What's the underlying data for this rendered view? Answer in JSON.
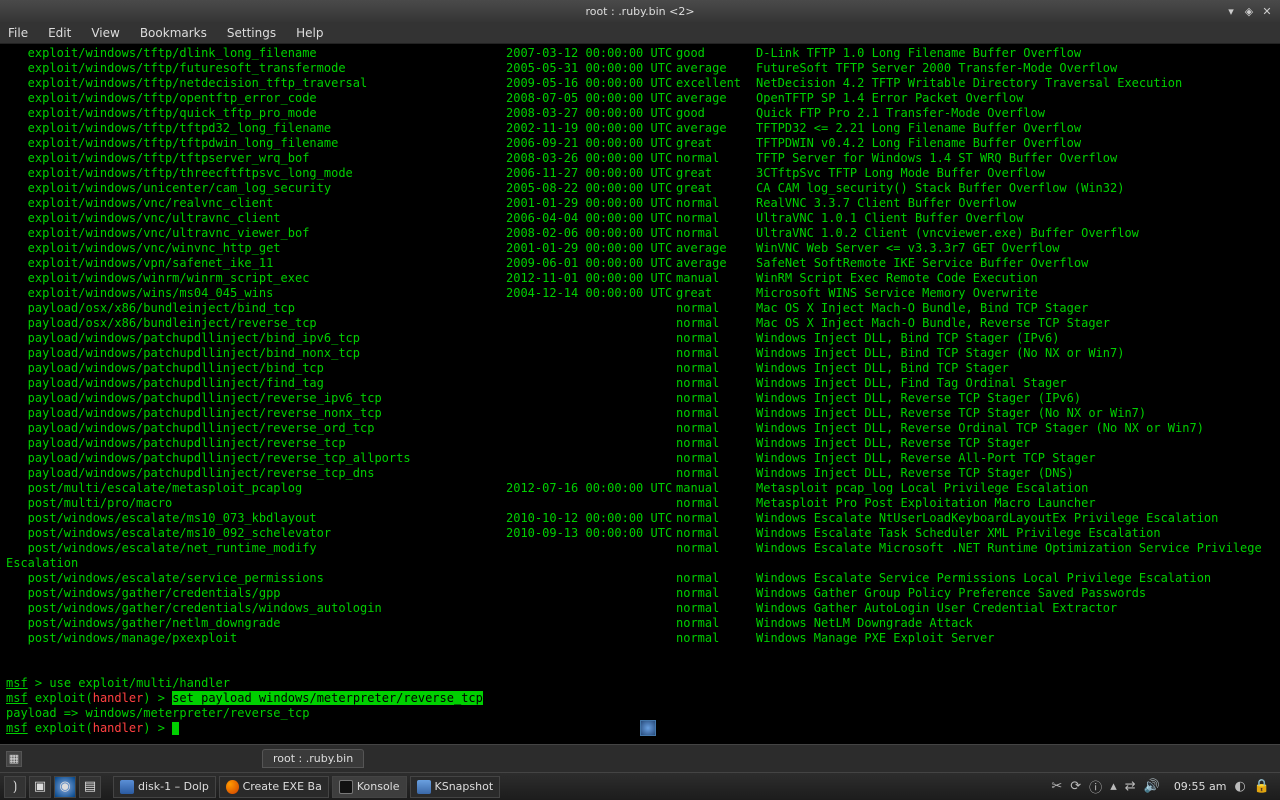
{
  "window": {
    "title": "root : .ruby.bin <2>",
    "min": "▾",
    "max": "◈",
    "close": "✕"
  },
  "menu": {
    "file": "File",
    "edit": "Edit",
    "view": "View",
    "bookmarks": "Bookmarks",
    "settings": "Settings",
    "help": "Help"
  },
  "table": {
    "rows": [
      {
        "n": "exploit/windows/tftp/dlink_long_filename",
        "d": "2007-03-12 00:00:00 UTC",
        "r": "good",
        "desc": "D-Link TFTP 1.0 Long Filename Buffer Overflow"
      },
      {
        "n": "exploit/windows/tftp/futuresoft_transfermode",
        "d": "2005-05-31 00:00:00 UTC",
        "r": "average",
        "desc": "FutureSoft TFTP Server 2000 Transfer-Mode Overflow"
      },
      {
        "n": "exploit/windows/tftp/netdecision_tftp_traversal",
        "d": "2009-05-16 00:00:00 UTC",
        "r": "excellent",
        "desc": "NetDecision 4.2 TFTP Writable Directory Traversal Execution"
      },
      {
        "n": "exploit/windows/tftp/opentftp_error_code",
        "d": "2008-07-05 00:00:00 UTC",
        "r": "average",
        "desc": "OpenTFTP SP 1.4 Error Packet Overflow"
      },
      {
        "n": "exploit/windows/tftp/quick_tftp_pro_mode",
        "d": "2008-03-27 00:00:00 UTC",
        "r": "good",
        "desc": "Quick FTP Pro 2.1 Transfer-Mode Overflow"
      },
      {
        "n": "exploit/windows/tftp/tftpd32_long_filename",
        "d": "2002-11-19 00:00:00 UTC",
        "r": "average",
        "desc": "TFTPD32 <= 2.21 Long Filename Buffer Overflow"
      },
      {
        "n": "exploit/windows/tftp/tftpdwin_long_filename",
        "d": "2006-09-21 00:00:00 UTC",
        "r": "great",
        "desc": "TFTPDWIN v0.4.2 Long Filename Buffer Overflow"
      },
      {
        "n": "exploit/windows/tftp/tftpserver_wrq_bof",
        "d": "2008-03-26 00:00:00 UTC",
        "r": "normal",
        "desc": "TFTP Server for Windows 1.4 ST WRQ Buffer Overflow"
      },
      {
        "n": "exploit/windows/tftp/threecftftpsvc_long_mode",
        "d": "2006-11-27 00:00:00 UTC",
        "r": "great",
        "desc": "3CTftpSvc TFTP Long Mode Buffer Overflow"
      },
      {
        "n": "exploit/windows/unicenter/cam_log_security",
        "d": "2005-08-22 00:00:00 UTC",
        "r": "great",
        "desc": "CA CAM log_security() Stack Buffer Overflow (Win32)"
      },
      {
        "n": "exploit/windows/vnc/realvnc_client",
        "d": "2001-01-29 00:00:00 UTC",
        "r": "normal",
        "desc": "RealVNC 3.3.7 Client Buffer Overflow"
      },
      {
        "n": "exploit/windows/vnc/ultravnc_client",
        "d": "2006-04-04 00:00:00 UTC",
        "r": "normal",
        "desc": "UltraVNC 1.0.1 Client Buffer Overflow"
      },
      {
        "n": "exploit/windows/vnc/ultravnc_viewer_bof",
        "d": "2008-02-06 00:00:00 UTC",
        "r": "normal",
        "desc": "UltraVNC 1.0.2 Client (vncviewer.exe) Buffer Overflow"
      },
      {
        "n": "exploit/windows/vnc/winvnc_http_get",
        "d": "2001-01-29 00:00:00 UTC",
        "r": "average",
        "desc": "WinVNC Web Server <= v3.3.3r7 GET Overflow"
      },
      {
        "n": "exploit/windows/vpn/safenet_ike_11",
        "d": "2009-06-01 00:00:00 UTC",
        "r": "average",
        "desc": "SafeNet SoftRemote IKE Service Buffer Overflow"
      },
      {
        "n": "exploit/windows/winrm/winrm_script_exec",
        "d": "2012-11-01 00:00:00 UTC",
        "r": "manual",
        "desc": "WinRM Script Exec Remote Code Execution"
      },
      {
        "n": "exploit/windows/wins/ms04_045_wins",
        "d": "2004-12-14 00:00:00 UTC",
        "r": "great",
        "desc": "Microsoft WINS Service Memory Overwrite"
      },
      {
        "n": "payload/osx/x86/bundleinject/bind_tcp",
        "d": "",
        "r": "normal",
        "desc": "Mac OS X Inject Mach-O Bundle, Bind TCP Stager"
      },
      {
        "n": "payload/osx/x86/bundleinject/reverse_tcp",
        "d": "",
        "r": "normal",
        "desc": "Mac OS X Inject Mach-O Bundle, Reverse TCP Stager"
      },
      {
        "n": "payload/windows/patchupdllinject/bind_ipv6_tcp",
        "d": "",
        "r": "normal",
        "desc": "Windows Inject DLL, Bind TCP Stager (IPv6)"
      },
      {
        "n": "payload/windows/patchupdllinject/bind_nonx_tcp",
        "d": "",
        "r": "normal",
        "desc": "Windows Inject DLL, Bind TCP Stager (No NX or Win7)"
      },
      {
        "n": "payload/windows/patchupdllinject/bind_tcp",
        "d": "",
        "r": "normal",
        "desc": "Windows Inject DLL, Bind TCP Stager"
      },
      {
        "n": "payload/windows/patchupdllinject/find_tag",
        "d": "",
        "r": "normal",
        "desc": "Windows Inject DLL, Find Tag Ordinal Stager"
      },
      {
        "n": "payload/windows/patchupdllinject/reverse_ipv6_tcp",
        "d": "",
        "r": "normal",
        "desc": "Windows Inject DLL, Reverse TCP Stager (IPv6)"
      },
      {
        "n": "payload/windows/patchupdllinject/reverse_nonx_tcp",
        "d": "",
        "r": "normal",
        "desc": "Windows Inject DLL, Reverse TCP Stager (No NX or Win7)"
      },
      {
        "n": "payload/windows/patchupdllinject/reverse_ord_tcp",
        "d": "",
        "r": "normal",
        "desc": "Windows Inject DLL, Reverse Ordinal TCP Stager (No NX or Win7)"
      },
      {
        "n": "payload/windows/patchupdllinject/reverse_tcp",
        "d": "",
        "r": "normal",
        "desc": "Windows Inject DLL, Reverse TCP Stager"
      },
      {
        "n": "payload/windows/patchupdllinject/reverse_tcp_allports",
        "d": "",
        "r": "normal",
        "desc": "Windows Inject DLL, Reverse All-Port TCP Stager"
      },
      {
        "n": "payload/windows/patchupdllinject/reverse_tcp_dns",
        "d": "",
        "r": "normal",
        "desc": "Windows Inject DLL, Reverse TCP Stager (DNS)"
      },
      {
        "n": "post/multi/escalate/metasploit_pcaplog",
        "d": "2012-07-16 00:00:00 UTC",
        "r": "manual",
        "desc": "Metasploit pcap_log Local Privilege Escalation"
      },
      {
        "n": "post/multi/pro/macro",
        "d": "",
        "r": "normal",
        "desc": "Metasploit Pro Post Exploitation Macro Launcher"
      },
      {
        "n": "post/windows/escalate/ms10_073_kbdlayout",
        "d": "2010-10-12 00:00:00 UTC",
        "r": "normal",
        "desc": "Windows Escalate NtUserLoadKeyboardLayoutEx Privilege Escalation"
      },
      {
        "n": "post/windows/escalate/ms10_092_schelevator",
        "d": "2010-09-13 00:00:00 UTC",
        "r": "normal",
        "desc": "Windows Escalate Task Scheduler XML Privilege Escalation"
      },
      {
        "n": "post/windows/escalate/net_runtime_modify",
        "d": "",
        "r": "normal",
        "desc": "Windows Escalate Microsoft .NET Runtime Optimization Service Privilege",
        "wrap": "Escalation"
      },
      {
        "n": "post/windows/escalate/service_permissions",
        "d": "",
        "r": "normal",
        "desc": "Windows Escalate Service Permissions Local Privilege Escalation"
      },
      {
        "n": "post/windows/gather/credentials/gpp",
        "d": "",
        "r": "normal",
        "desc": "Windows Gather Group Policy Preference Saved Passwords"
      },
      {
        "n": "post/windows/gather/credentials/windows_autologin",
        "d": "",
        "r": "normal",
        "desc": "Windows Gather AutoLogin User Credential Extractor"
      },
      {
        "n": "post/windows/gather/netlm_downgrade",
        "d": "",
        "r": "normal",
        "desc": "Windows NetLM Downgrade Attack"
      },
      {
        "n": "post/windows/manage/pxexploit",
        "d": "",
        "r": "normal",
        "desc": "Windows Manage PXE Exploit Server"
      }
    ]
  },
  "prompt": {
    "msf": "msf",
    "gt": " > ",
    "exploit_open": " exploit(",
    "handler": "handler",
    "close_paren": ") > ",
    "cmd_use": "use exploit/multi/handler",
    "cmd_set": "set payload windows/meterpreter/reverse_tcp",
    "result": "payload => windows/meterpreter/reverse_tcp"
  },
  "tabbar": {
    "tab1": "root : .ruby.bin"
  },
  "panel": {
    "tasks": [
      {
        "label": "disk-1 – Dolp",
        "icon": "folder"
      },
      {
        "label": "Create EXE Ba",
        "icon": "ff"
      },
      {
        "label": "Konsole",
        "icon": "term",
        "active": true
      },
      {
        "label": "KSnapshot",
        "icon": "snap"
      }
    ],
    "clock": "09:55 am"
  }
}
